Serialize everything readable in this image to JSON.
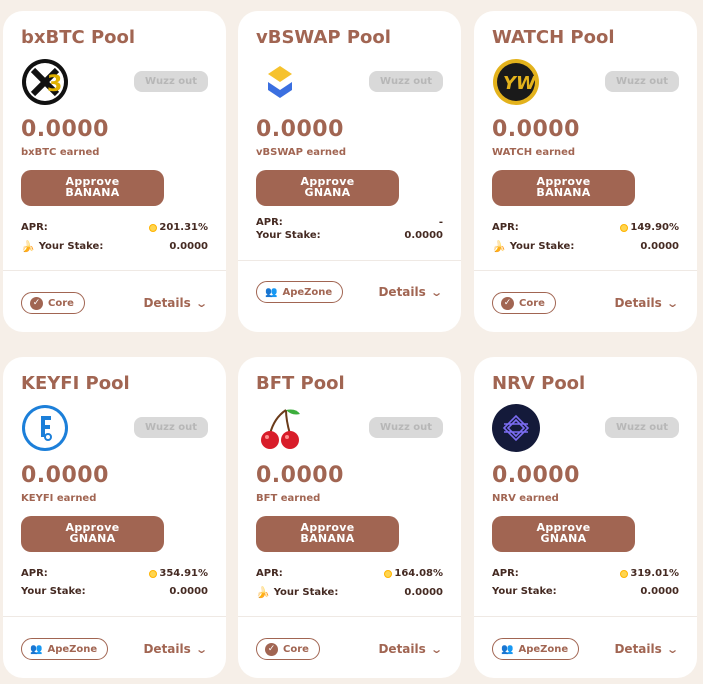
{
  "pools": [
    {
      "title": "bxBTC Pool",
      "logo": "bxbtc-logo",
      "wuzz": "Wuzz out",
      "amount": "0.0000",
      "earned": "bxBTC earned",
      "approve_line1": "Approve",
      "approve_line2": "BANANA",
      "apr_label": "APR:",
      "apr_value": "201.31%",
      "stake_label": "Your Stake:",
      "stake_value": "0.0000",
      "tag": "Core",
      "details": "Details"
    },
    {
      "title": "vBSWAP Pool",
      "logo": "vbswap-logo",
      "wuzz": "Wuzz out",
      "amount": "0.0000",
      "earned": "vBSWAP earned",
      "approve_line1": "Approve",
      "approve_line2": "GNANA",
      "apr_label": "APR:",
      "apr_value": "-",
      "stake_label": "Your Stake:",
      "stake_value": "0.0000",
      "tag": "ApeZone",
      "details": "Details"
    },
    {
      "title": "WATCH Pool",
      "logo": "watch-logo",
      "wuzz": "Wuzz out",
      "amount": "0.0000",
      "earned": "WATCH earned",
      "approve_line1": "Approve",
      "approve_line2": "BANANA",
      "apr_label": "APR:",
      "apr_value": "149.90%",
      "stake_label": "Your Stake:",
      "stake_value": "0.0000",
      "tag": "Core",
      "details": "Details"
    },
    {
      "title": "KEYFI Pool",
      "logo": "keyfi-logo",
      "wuzz": "Wuzz out",
      "amount": "0.0000",
      "earned": "KEYFI earned",
      "approve_line1": "Approve",
      "approve_line2": "GNANA",
      "apr_label": "APR:",
      "apr_value": "354.91%",
      "stake_label": "Your Stake:",
      "stake_value": "0.0000",
      "tag": "ApeZone",
      "details": "Details"
    },
    {
      "title": "BFT Pool",
      "logo": "bft-cherries-logo",
      "wuzz": "Wuzz out",
      "amount": "0.0000",
      "earned": "BFT earned",
      "approve_line1": "Approve",
      "approve_line2": "BANANA",
      "apr_label": "APR:",
      "apr_value": "164.08%",
      "stake_label": "Your Stake:",
      "stake_value": "0.0000",
      "tag": "Core",
      "details": "Details"
    },
    {
      "title": "NRV Pool",
      "logo": "nrv-logo",
      "wuzz": "Wuzz out",
      "amount": "0.0000",
      "earned": "NRV earned",
      "approve_line1": "Approve",
      "approve_line2": "GNANA",
      "apr_label": "APR:",
      "apr_value": "319.01%",
      "stake_label": "Your Stake:",
      "stake_value": "0.0000",
      "tag": "ApeZone",
      "details": "Details"
    }
  ],
  "colors": {
    "brand": "#a16552",
    "card": "#ffffff",
    "background": "#f6efe8",
    "disabled": "#d9d9d9"
  }
}
